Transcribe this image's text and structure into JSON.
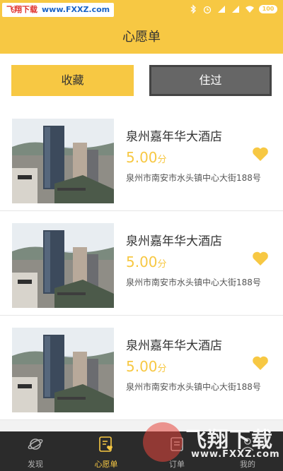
{
  "watermark": {
    "top_left_brand": "飞翔下载",
    "top_left_domain": "www.FXXZ.com",
    "bottom_right_brand": "飞翔下载",
    "bottom_right_domain": "www.FXXZ.com"
  },
  "statusbar": {
    "battery": "100"
  },
  "header": {
    "title": "心愿单"
  },
  "tabs": [
    {
      "label": "收藏",
      "active": true
    },
    {
      "label": "住过",
      "active": false
    }
  ],
  "hotels": [
    {
      "name": "泉州嘉年华大酒店",
      "score": "5.00",
      "score_unit": "分",
      "address": "泉州市南安市水头镇中心大街188号",
      "favorited": true
    },
    {
      "name": "泉州嘉年华大酒店",
      "score": "5.00",
      "score_unit": "分",
      "address": "泉州市南安市水头镇中心大街188号",
      "favorited": true
    },
    {
      "name": "泉州嘉年华大酒店",
      "score": "5.00",
      "score_unit": "分",
      "address": "泉州市南安市水头镇中心大街188号",
      "favorited": true
    }
  ],
  "bottom_nav": [
    {
      "label": "发现",
      "icon": "planet-icon",
      "active": false
    },
    {
      "label": "心愿单",
      "icon": "wishlist-icon",
      "active": true
    },
    {
      "label": "订单",
      "icon": "order-icon",
      "active": false
    },
    {
      "label": "我的",
      "icon": "profile-icon",
      "active": false
    }
  ],
  "colors": {
    "accent": "#f7c843",
    "tab_inactive": "#666666",
    "nav_bg": "#2b2b2b"
  }
}
